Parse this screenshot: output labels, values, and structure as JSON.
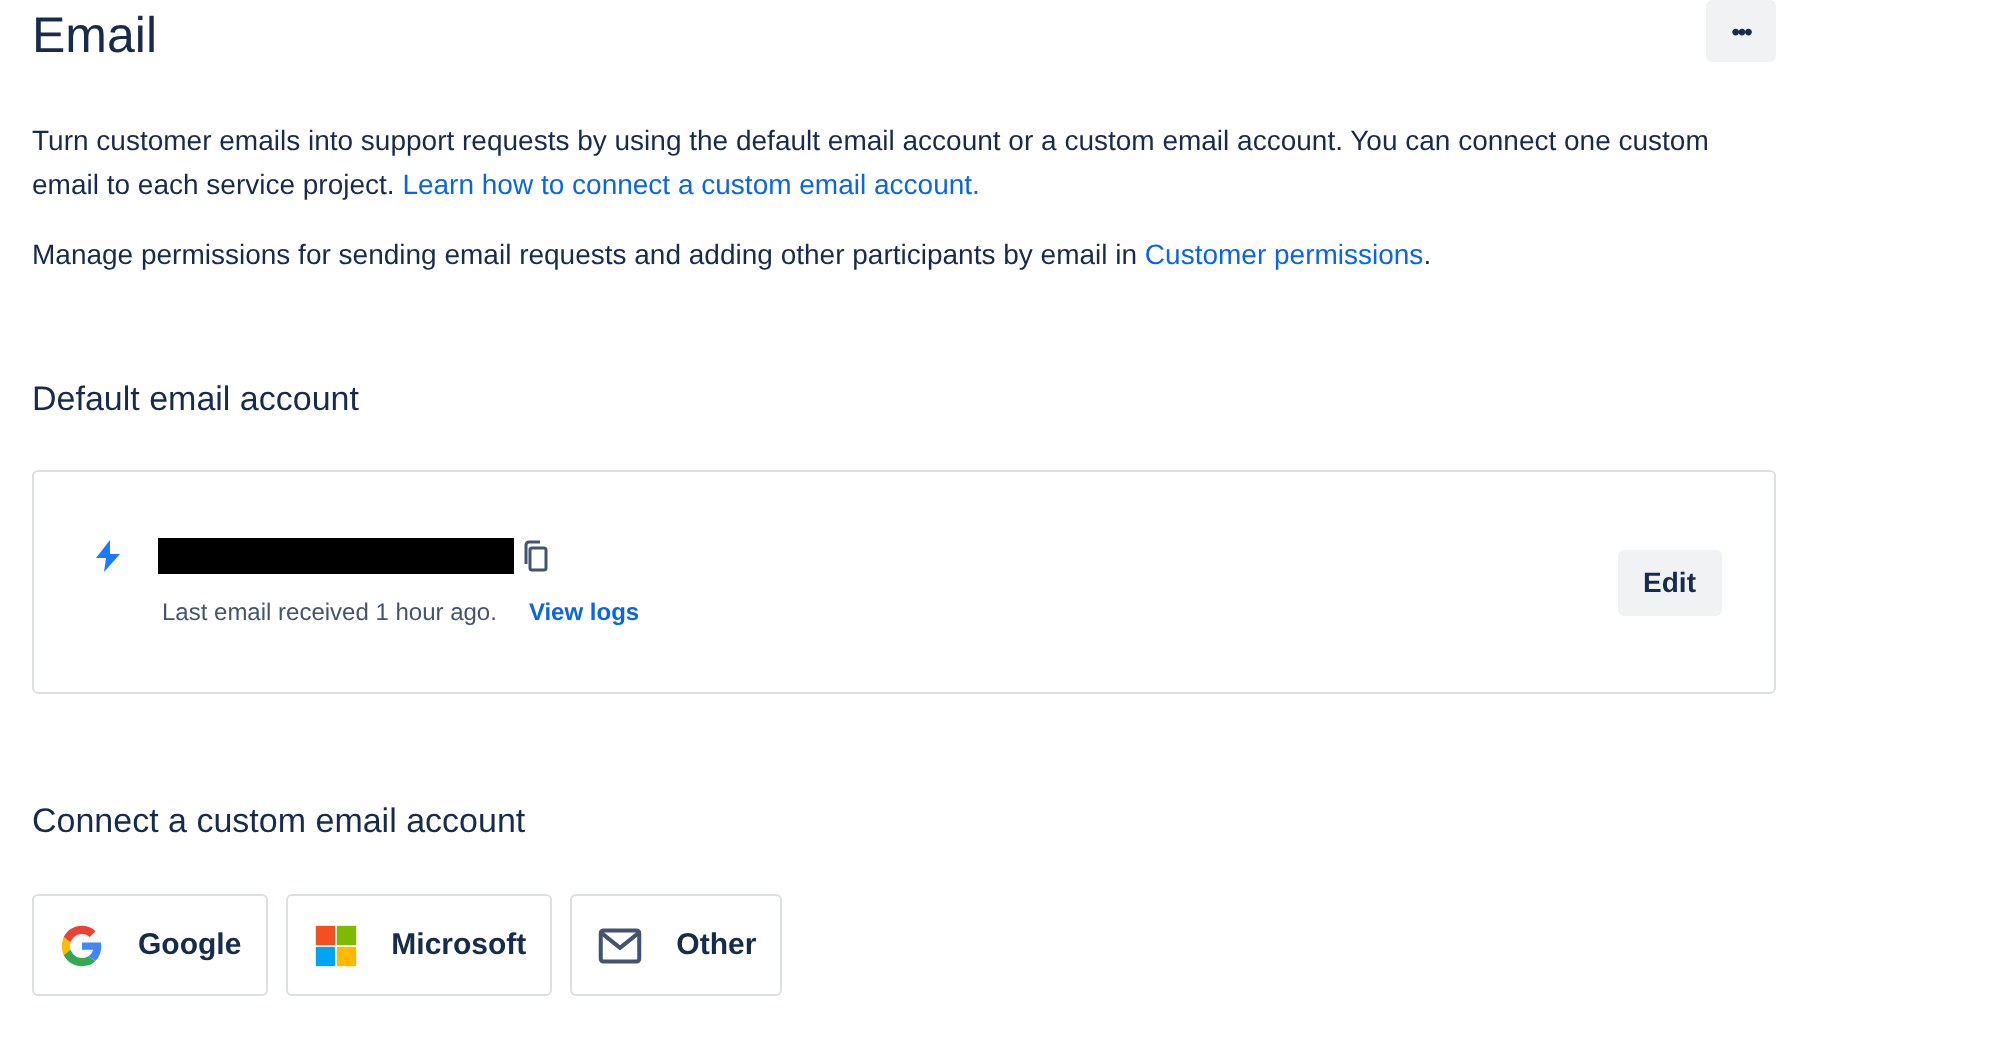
{
  "header": {
    "title": "Email",
    "more_button": "•••"
  },
  "intro": [
    {
      "text": "Turn customer emails into support requests by using the default email account or a custom email account. You can connect one custom email to each service project. ",
      "link": "Learn how to connect a custom email account."
    },
    {
      "text": "Manage permissions for sending email requests and adding other participants by email in ",
      "link": "Customer permissions",
      "after": "."
    }
  ],
  "default_account": {
    "heading": "Default email account",
    "status": "Last email received 1 hour ago.",
    "logs_link": "View logs",
    "edit_button": "Edit"
  },
  "custom_account": {
    "heading": "Connect a custom email account",
    "providers": [
      {
        "kind": "google",
        "label": "Google"
      },
      {
        "kind": "microsoft",
        "label": "Microsoft"
      },
      {
        "kind": "other",
        "label": "Other"
      }
    ]
  }
}
